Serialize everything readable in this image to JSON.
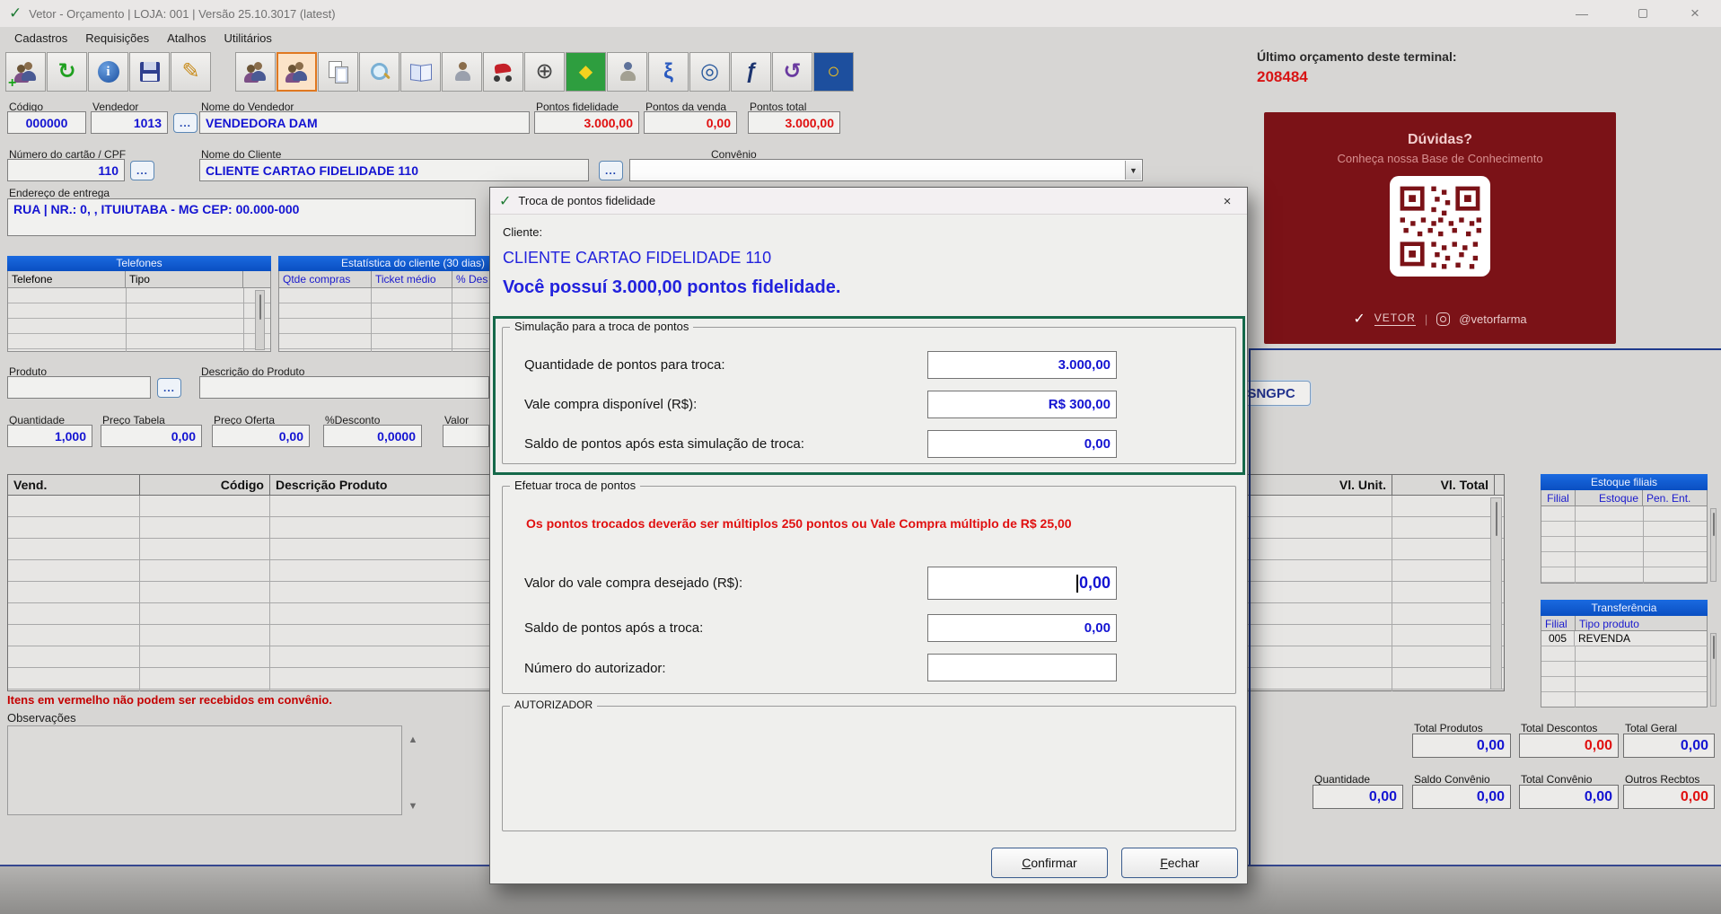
{
  "palette": {
    "accent_blue": "#1414d2",
    "value_red": "#e01010",
    "table_header_blue": "#0d58cf",
    "green_frame": "#15694a",
    "promo_bg": "#7b1217",
    "last_budget_red": "#d81414"
  },
  "titlebar": {
    "app_icon": "✓",
    "title": "Vetor - Orçamento    |    LOJA: 001    |    Versão 25.10.3017 (latest)",
    "minimize_glyph": "—",
    "close_glyph": "×"
  },
  "menubar": {
    "items": [
      "Cadastros",
      "Requisições",
      "Atalhos",
      "Utilitários"
    ]
  },
  "toolbar": {
    "buttons": [
      {
        "name": "add-client",
        "glyph": ""
      },
      {
        "name": "sync",
        "glyph": "↻"
      },
      {
        "name": "info",
        "glyph": "i"
      },
      {
        "name": "save",
        "glyph": ""
      },
      {
        "name": "edit",
        "glyph": "✎"
      },
      {
        "name": "customers",
        "glyph": ""
      },
      {
        "name": "customer-card-search",
        "glyph": ""
      },
      {
        "name": "copy-document",
        "glyph": ""
      },
      {
        "name": "search",
        "glyph": ""
      },
      {
        "name": "catalog",
        "glyph": ""
      },
      {
        "name": "customer",
        "glyph": ""
      },
      {
        "name": "delivery",
        "glyph": ""
      },
      {
        "name": "ecommerce",
        "glyph": "⊕"
      },
      {
        "name": "brazil-flag",
        "glyph": "◆"
      },
      {
        "name": "mobility",
        "glyph": ""
      },
      {
        "name": "sngpc-symbol",
        "glyph": "ξ"
      },
      {
        "name": "swirl",
        "glyph": "◎"
      },
      {
        "name": "formula-f",
        "glyph": "ƒ"
      },
      {
        "name": "sync-arrows",
        "glyph": "↺"
      },
      {
        "name": "ring",
        "glyph": "○"
      }
    ]
  },
  "header_right": {
    "last_budget_label": "Último orçamento deste terminal:",
    "last_budget_value": "208484"
  },
  "promo": {
    "title": "Dúvidas?",
    "subtitle": "Conheça nossa Base de Conhecimento",
    "check": "✓",
    "brand": "VETOR",
    "divider": "|",
    "handle": "@vetorfarma"
  },
  "form": {
    "ellipsis": "...",
    "codigo_label": "Código",
    "codigo_value": "000000",
    "vendedor_label": "Vendedor",
    "vendedor_value": "1013",
    "nome_vendedor_label": "Nome do Vendedor",
    "nome_vendedor_value": "VENDEDORA DAM",
    "pontos_fidelidade_label": "Pontos fidelidade",
    "pontos_fidelidade_value": "3.000,00",
    "pontos_venda_label": "Pontos da venda",
    "pontos_venda_value": "0,00",
    "pontos_total_label": "Pontos total",
    "pontos_total_value": "3.000,00",
    "cartao_label": "Número do cartão / CPF",
    "cartao_value": "110",
    "nome_cliente_label": "Nome do Cliente",
    "nome_cliente_value": "CLIENTE CARTAO FIDELIDADE 110",
    "convenio_label": "Convênio",
    "convenio_value": "",
    "combo_arrow": "▼",
    "endereco_label": "Endereço de entrega",
    "endereco_value": "RUA | NR.: 0, , ITUIUTABA - MG CEP: 00.000-000"
  },
  "telefones": {
    "title": "Telefones",
    "headers": [
      "Telefone",
      "Tipo"
    ]
  },
  "estatistica": {
    "title": "Estatística do cliente (30 dias)",
    "headers": [
      "Qtde compras",
      "Ticket médio",
      "% Des"
    ]
  },
  "produto": {
    "produto_label": "Produto",
    "produto_value": "",
    "descricao_label": "Descrição do Produto",
    "descricao_value": "",
    "quantidade_label": "Quantidade",
    "quantidade_value": "1,000",
    "preco_tabela_label": "Preço Tabela",
    "preco_tabela_value": "0,00",
    "preco_oferta_label": "Preço Oferta",
    "preco_oferta_value": "0,00",
    "desconto_label": "%Desconto",
    "desconto_value": "0,0000",
    "valor_label": "Valor"
  },
  "items_table": {
    "headers": [
      "Vend.",
      "Código",
      "Descrição Produto",
      "Vl. Unit.",
      "Vl. Total"
    ]
  },
  "sngpc_label": "SNGPC",
  "estoque_filiais": {
    "title": "Estoque filiais",
    "headers": [
      "Filial",
      "Estoque",
      "Pen. Ent."
    ]
  },
  "transferencia": {
    "title": "Transferência",
    "headers": [
      "Filial",
      "Tipo produto"
    ],
    "rows": [
      [
        "005",
        "REVENDA"
      ]
    ]
  },
  "footer": {
    "warning": "Itens em vermelho não podem ser recebidos em convênio.",
    "observacoes_label": "Observações",
    "scroll_up": "▲",
    "scroll_down": "▼"
  },
  "totals": {
    "total_produtos_label": "Total Produtos",
    "total_produtos_value": "0,00",
    "total_descontos_label": "Total Descontos",
    "total_descontos_value": "0,00",
    "total_geral_label": "Total Geral",
    "total_geral_value": "0,00",
    "quantidade_label": "Quantidade",
    "quantidade_value": "0,00",
    "saldo_convenio_label": "Saldo Convênio",
    "saldo_convenio_value": "0,00",
    "total_convenio_label": "Total Convênio",
    "total_convenio_value": "0,00",
    "outros_recbtos_label": "Outros Recbtos",
    "outros_recbtos_value": "0,00"
  },
  "dialog": {
    "icon": "✓",
    "title": "Troca de pontos fidelidade",
    "close_glyph": "×",
    "cliente_label": "Cliente:",
    "cliente_nome": "CLIENTE CARTAO FIDELIDADE 110",
    "saldo_msg": "Você possuí 3.000,00 pontos fidelidade.",
    "simulacao": {
      "legend": "Simulação para a troca de pontos",
      "rows": [
        {
          "label": "Quantidade de pontos para troca:",
          "value": "3.000,00"
        },
        {
          "label": "Vale compra disponível (R$):",
          "value": "R$ 300,00"
        },
        {
          "label": "Saldo de pontos após esta simulação de troca:",
          "value": "0,00"
        }
      ]
    },
    "efetuar": {
      "legend": "Efetuar troca de pontos",
      "warning": "Os pontos trocados deverão ser múltiplos 250 pontos ou Vale Compra múltiplo de R$ 25,00",
      "rows": [
        {
          "label": "Valor do vale compra desejado (R$):",
          "value": "0,00"
        },
        {
          "label": "Saldo de pontos após a troca:",
          "value": "0,00"
        },
        {
          "label": "Número do autorizador:",
          "value": ""
        }
      ]
    },
    "autorizador_legend": "AUTORIZADOR",
    "buttons": {
      "confirm": "Confirmar",
      "close": "Fechar"
    }
  }
}
